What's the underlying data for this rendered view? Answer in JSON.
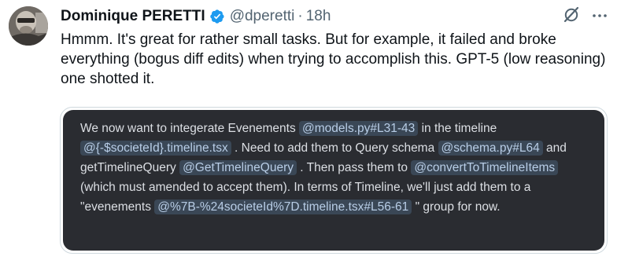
{
  "author": {
    "name": "Dominique PERETTI",
    "handle": "@dperetti",
    "separator": "·",
    "time": "18h",
    "avatar_icon": "avatar-photo",
    "verified_color": "#1d9bf0"
  },
  "post": {
    "text": "Hmmm. It's great for rather small tasks. But for example, it failed and broke everything (bogus diff edits) when trying to accomplish this. GPT-5 (low reasoning) one shotted it."
  },
  "actions": {
    "grok_icon": "grok-icon",
    "more_icon": "more-icon"
  },
  "embed": {
    "segments": [
      {
        "text": "We now want to integerate Evenements ",
        "chip": false
      },
      {
        "text": "@models.py#L31-43",
        "chip": true
      },
      {
        "text": "  in the timeline ",
        "chip": false
      },
      {
        "text": "@{-$societeId}.timeline.tsx",
        "chip": true
      },
      {
        "text": " . Need to add them to Query schema ",
        "chip": false
      },
      {
        "text": "@schema.py#L64",
        "chip": true
      },
      {
        "text": " and getTimelineQuery ",
        "chip": false
      },
      {
        "text": "@GetTimelineQuery",
        "chip": true
      },
      {
        "text": " . Then pass them to ",
        "chip": false
      },
      {
        "text": "@convertToTimelineItems",
        "chip": true
      },
      {
        "text": "  (which must amended to accept them). In terms of Timeline, we'll just add them to a \"evenements ",
        "chip": false
      },
      {
        "text": "@%7B-%24societeId%7D.timeline.tsx#L56-61",
        "chip": true
      },
      {
        "text": " \" group for now.",
        "chip": false
      }
    ],
    "chip_bg": "#3a4756",
    "chip_text": "#b8cde6",
    "background": "#2a2c31"
  }
}
